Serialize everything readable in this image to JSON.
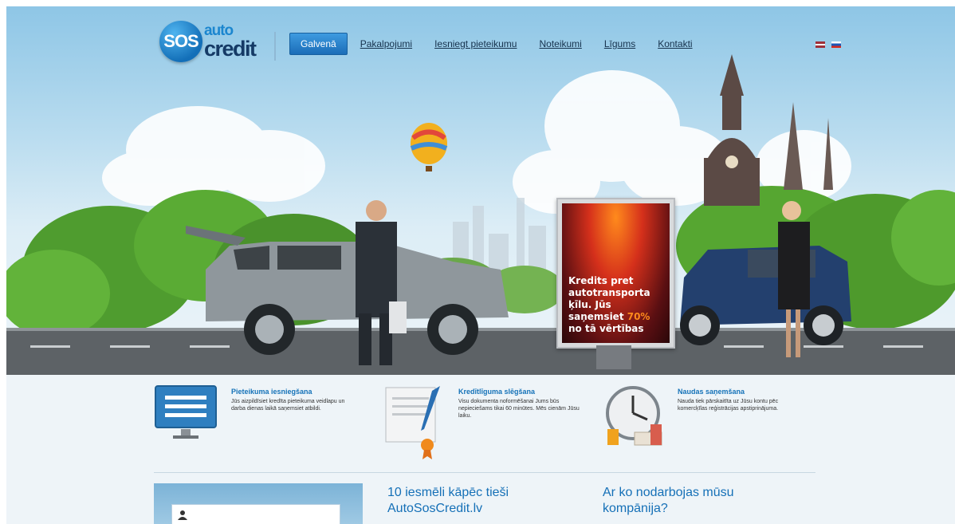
{
  "logo": {
    "sos": "SOS",
    "auto": "auto",
    "credit": "credit"
  },
  "nav": {
    "items": [
      {
        "label": "Galvenā",
        "active": true
      },
      {
        "label": "Pakalpojumi"
      },
      {
        "label": "Iesniegt pieteikumu"
      },
      {
        "label": "Noteikumi"
      },
      {
        "label": "Līgums"
      },
      {
        "label": "Kontakti"
      }
    ]
  },
  "flags": [
    "latvian-flag-icon",
    "russian-flag-icon"
  ],
  "billboard": {
    "line1": "Kredits pret",
    "line2": "autotransporta",
    "line3": "ķīlu. Jūs",
    "line4_pre": "saņemsiet ",
    "line4_highlight": "70%",
    "line5": "no tā vērtības"
  },
  "steps": [
    {
      "title": "Pieteikuma iesniegšana",
      "text": "Jūs aizpildīsiet kredīta pieteikuma veidlapu un darba dienas laikā saņemsiet atbildi.",
      "icon": "monitor-form-icon"
    },
    {
      "title": "Kredītlīguma slēgšana",
      "text": "Visu dokumenta noformēšanai Jums būs nepieciešams tikai 60 minūtes. Mēs cienām Jūsu laiku.",
      "icon": "document-pen-icon"
    },
    {
      "title": "Naudas saņemšana",
      "text": "Nauda tiek pārskaitīta uz Jūsu kontu pēc komercķīlas reģistrācijas apstiprinājuma.",
      "icon": "clock-money-icon"
    }
  ],
  "sections": {
    "reasons_line1": "10 iesmēli kāpēc tieši",
    "reasons_line2": "AutoSosCredit.lv",
    "company_line1": "Ar ko nodarbojas mūsu",
    "company_line2": "kompānija?"
  },
  "colors": {
    "accent": "#1572b8",
    "nav_active": "#2f86d0",
    "billboard_highlight": "#ff8a1c"
  }
}
